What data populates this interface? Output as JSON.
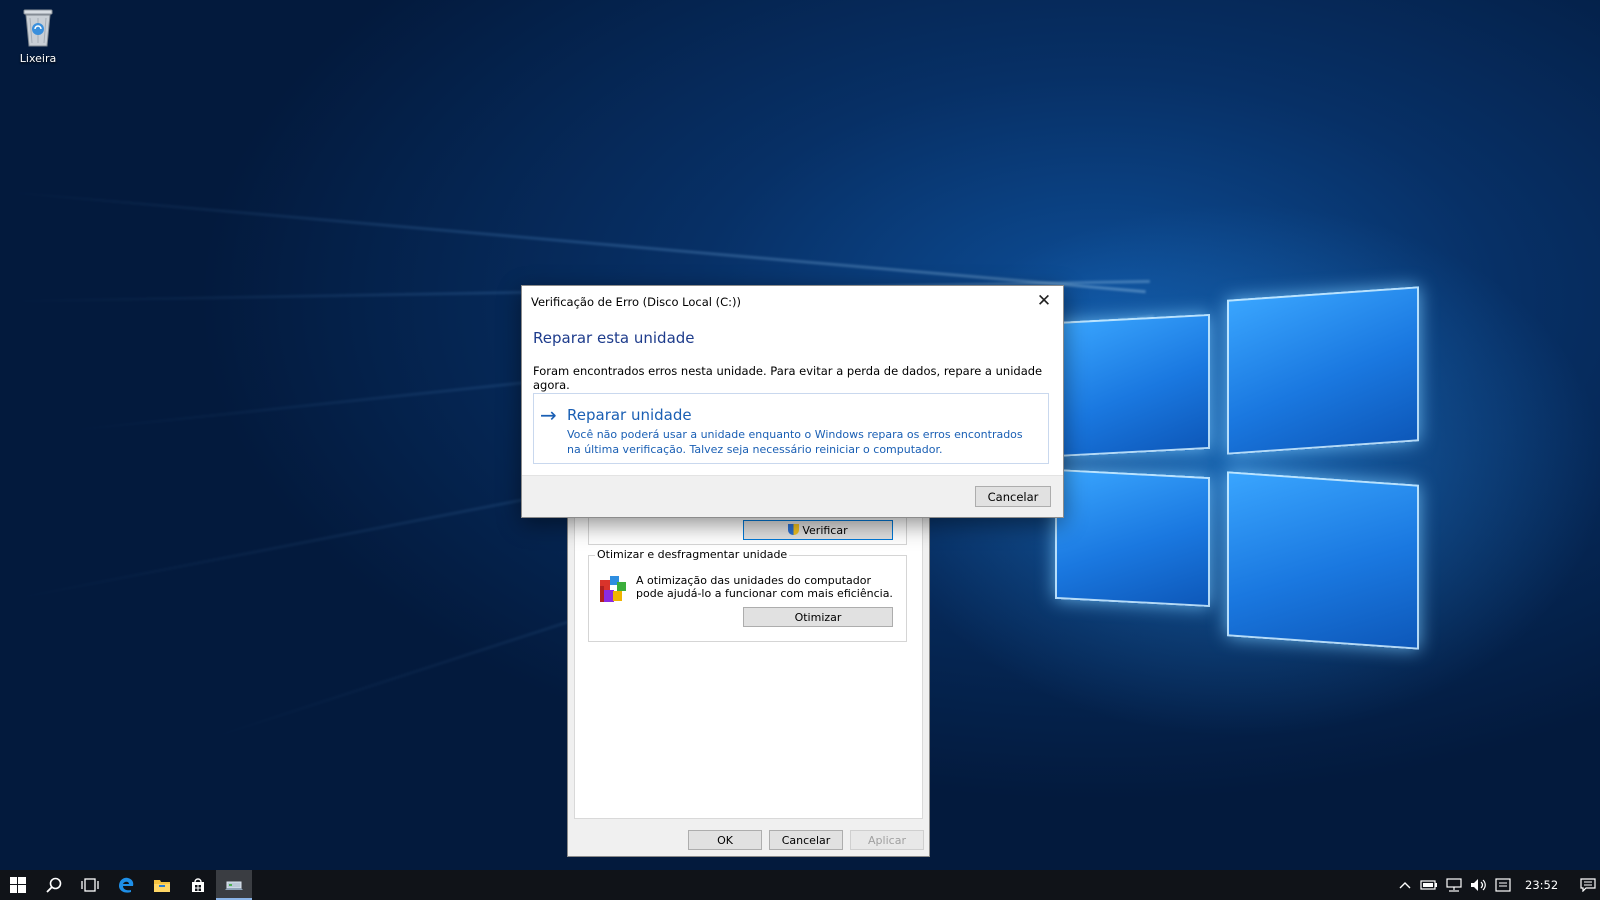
{
  "desktop": {
    "recycle_bin_label": "Lixeira"
  },
  "drive_properties": {
    "check_button_label": "Verificar",
    "optimize_group_title": "Otimizar e desfragmentar unidade",
    "optimize_description": "A otimização das unidades do computador pode ajudá-lo a funcionar com mais eficiência.",
    "optimize_button_label": "Otimizar",
    "ok_label": "OK",
    "cancel_label": "Cancelar",
    "apply_label": "Aplicar"
  },
  "error_dialog": {
    "title": "Verificação de Erro (Disco Local (C:))",
    "close_glyph": "✕",
    "heading": "Reparar esta unidade",
    "message": "Foram encontrados erros nesta unidade. Para evitar a perda de dados, repare a unidade agora.",
    "repair_option": {
      "arrow": "→",
      "title": "Reparar unidade",
      "description": "Você não poderá usar a unidade enquanto o Windows repara os erros encontrados na última verificação. Talvez seja necessário reiniciar o computador."
    },
    "cancel_label": "Cancelar"
  },
  "taskbar": {
    "clock": "23:52",
    "icons": [
      "windows-start-icon",
      "search-icon",
      "task-view-icon",
      "edge-icon",
      "file-explorer-icon",
      "store-icon",
      "disk-check-app-icon"
    ],
    "tray_chevron": "^",
    "accent": "#0078d7"
  }
}
